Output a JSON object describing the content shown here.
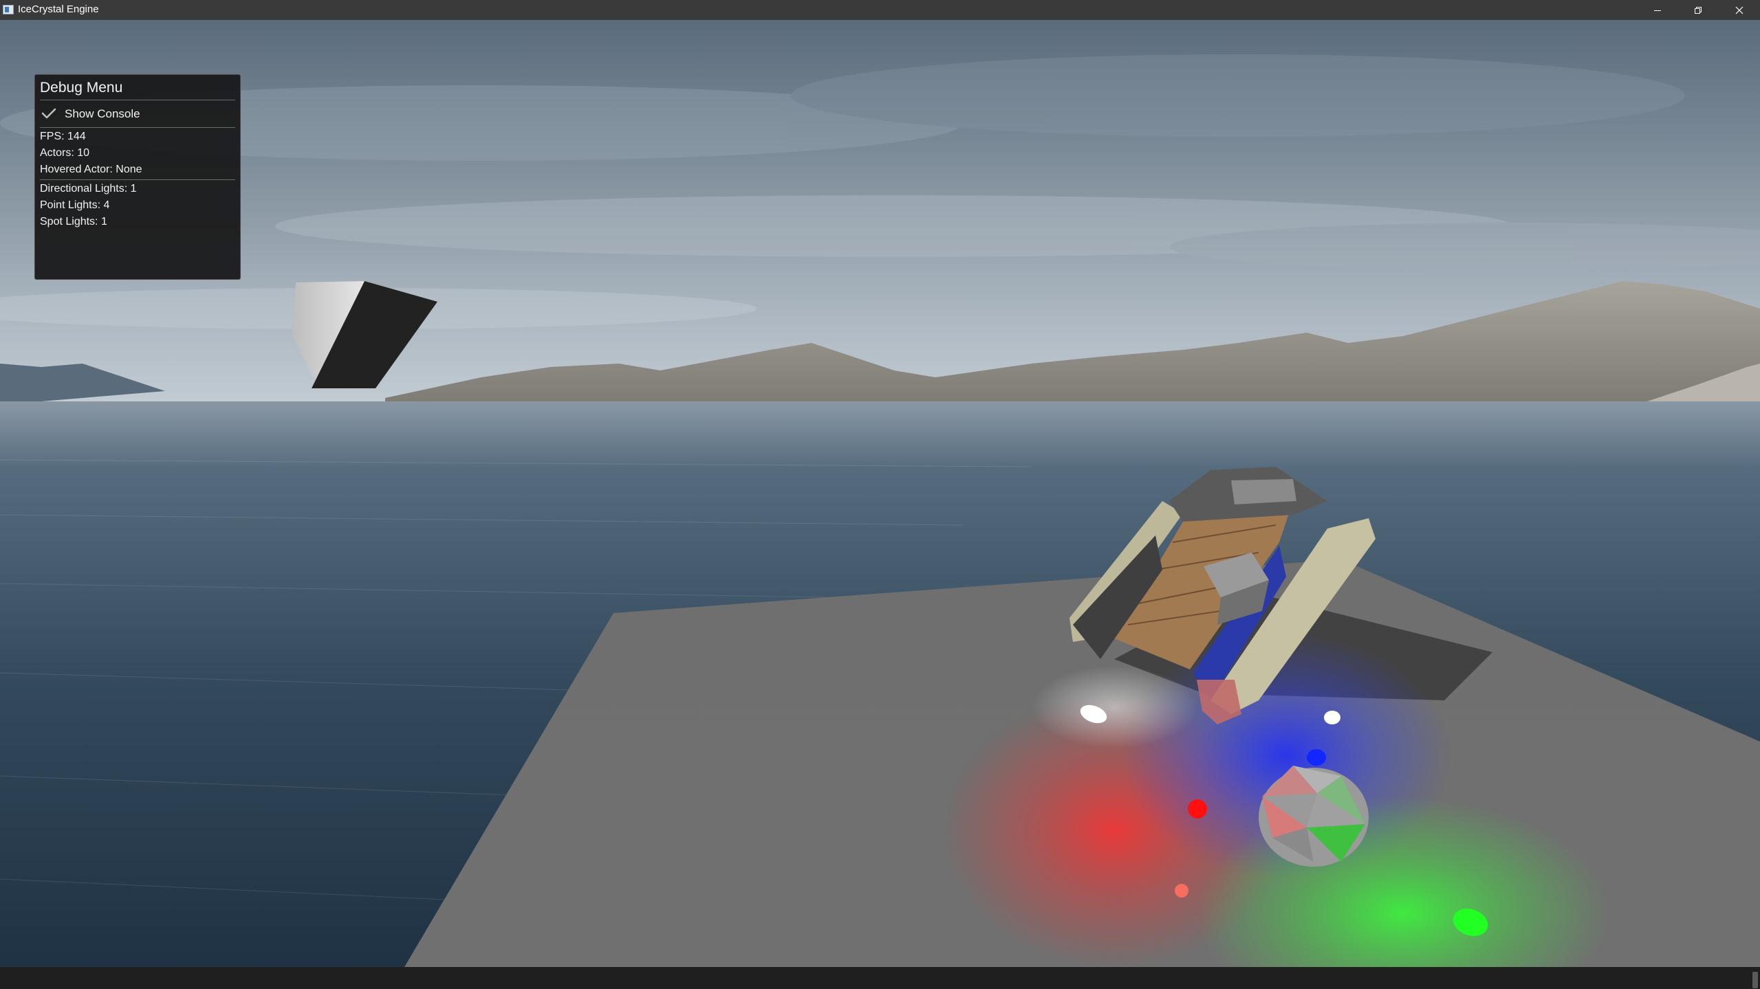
{
  "window": {
    "title": "IceCrystal Engine",
    "icon": "app-window-icon",
    "controls": [
      "minimize-icon",
      "restore-icon",
      "close-icon"
    ]
  },
  "debug_menu": {
    "title": "Debug Menu",
    "show_console": {
      "label": "Show Console",
      "checked": true
    },
    "stats": {
      "fps": "FPS: 144",
      "actors": "Actors: 10",
      "hovered_actor": "Hovered Actor: None",
      "directional_lights": "Directional Lights: 1",
      "point_lights": "Point Lights: 4",
      "spot_lights": "Spot Lights: 1"
    }
  },
  "scene": {
    "colors": {
      "sky_top": "#5e6f80",
      "sky_horizon": "#b9c3cb",
      "water": "#2e4356",
      "ground_plane": "#6e6e6e",
      "light_red": "#ff2020",
      "light_blue": "#1a2cff",
      "light_green": "#22ff22",
      "light_white": "#ffffff"
    }
  }
}
